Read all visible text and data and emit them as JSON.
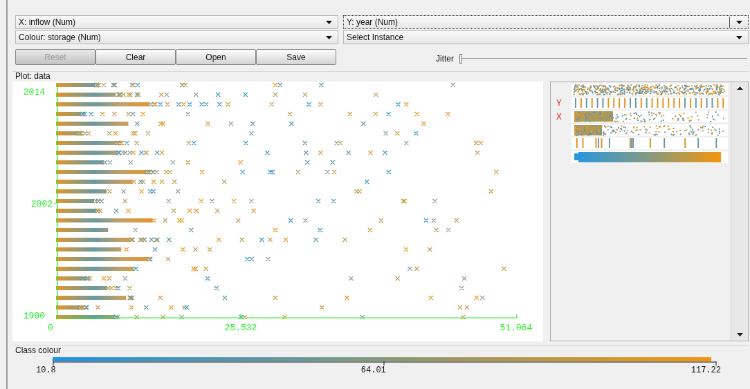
{
  "x_axis_select": {
    "value": "X: inflow (Num)"
  },
  "y_axis_select": {
    "value": "Y: year (Num)",
    "focused": true
  },
  "colour_select": {
    "value": "Colour: storage (Num)"
  },
  "instance_select": {
    "value": "Select Instance"
  },
  "buttons": [
    {
      "label": "Reset",
      "disabled": true
    },
    {
      "label": "Clear",
      "disabled": false
    },
    {
      "label": "Open",
      "disabled": false
    },
    {
      "label": "Save",
      "disabled": false
    }
  ],
  "jitter": {
    "label": "Jitter",
    "level": 0
  },
  "plot": {
    "title": "Plot: data",
    "x_ticks": [
      "0",
      "25.532",
      "51.064"
    ],
    "y_ticks": [
      "2014",
      "2002",
      "1990"
    ]
  },
  "attribute_panel": {
    "rows": [
      {
        "kind": "dense"
      },
      {
        "kind": "stripes",
        "axis_mark": "Y"
      },
      {
        "kind": "scatter",
        "axis_mark": "X"
      },
      {
        "kind": "scatter"
      },
      {
        "kind": "sparse_stripes"
      },
      {
        "kind": "gradient"
      }
    ]
  },
  "class_colour": {
    "title": "Class colour",
    "ticks": [
      "10.8",
      "64.01",
      "117.22"
    ]
  }
}
